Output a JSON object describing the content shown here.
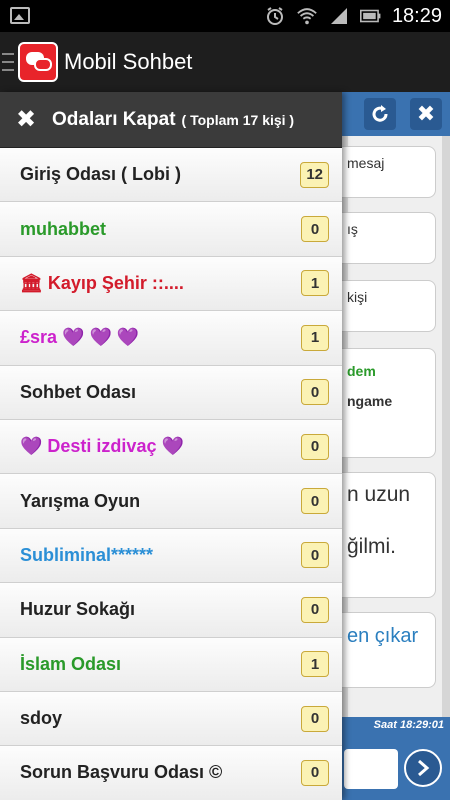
{
  "status_bar": {
    "time": "18:29",
    "icons": [
      "image-icon",
      "alarm-icon",
      "wifi-icon",
      "signal-icon",
      "battery-icon"
    ]
  },
  "app_bar": {
    "title": "Mobil Sohbet"
  },
  "drawer": {
    "close_label": "Odaları Kapat",
    "total_label": "( Toplam 17 kişi )",
    "rooms": [
      {
        "name": "Giriş Odası ( Lobi )",
        "count": "12",
        "color": "#222222"
      },
      {
        "name": "muhabbet",
        "count": "0",
        "color": "#2a9a2a"
      },
      {
        "name": "🏛 Kayıp Şehir ::....",
        "count": "1",
        "color": "#d31b2b"
      },
      {
        "name": "£sra 💜 💜 💜",
        "count": "1",
        "color": "#cc22cc"
      },
      {
        "name": "Sohbet Odası",
        "count": "0",
        "color": "#222222"
      },
      {
        "name": "💜 Desti izdivaç 💜",
        "count": "0",
        "color": "#cc22cc"
      },
      {
        "name": "Yarışma Oyun",
        "count": "0",
        "color": "#222222"
      },
      {
        "name": "Subliminal******",
        "count": "0",
        "color": "#2b8fd6"
      },
      {
        "name": "Huzur Sokağı",
        "count": "0",
        "color": "#222222"
      },
      {
        "name": "İslam Odası",
        "count": "1",
        "color": "#2a9a2a"
      },
      {
        "name": "sdoy",
        "count": "0",
        "color": "#222222"
      },
      {
        "name": "Sorun Başvuru Odası ©",
        "count": "0",
        "color": "#222222"
      }
    ]
  },
  "background": {
    "card1": "mesaj",
    "card2": "ış",
    "card3": "kişi",
    "card4a": "dem",
    "card4b": "ngame",
    "card5a": "n uzun",
    "card5b": "ğilmi.",
    "card6": "en çıkar",
    "saat": "Saat 18:29:01"
  },
  "colors": {
    "accent": "#3a72b0",
    "logo": "#e8242a",
    "count_badge": "#fbf2b4"
  }
}
